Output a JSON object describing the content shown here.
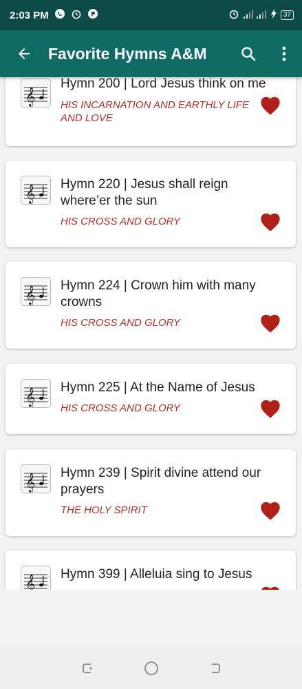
{
  "status_bar": {
    "time": "2:03 PM",
    "battery": "37"
  },
  "app_bar": {
    "title": "Favorite Hymns A&M"
  },
  "hymns": [
    {
      "title": "Hymn 200 | Lord Jesus think on me",
      "category": "HIS INCARNATION AND EARTHLY LIFE AND LOVE",
      "favorite": true
    },
    {
      "title": "Hymn 220 |  Jesus shall reign where’er the sun",
      "category": "HIS CROSS AND GLORY",
      "favorite": true
    },
    {
      "title": "Hymn 224 |  Crown him with many crowns",
      "category": "HIS CROSS AND GLORY",
      "favorite": true
    },
    {
      "title": "Hymn 225 |  At the Name of Jesus",
      "category": "HIS CROSS AND GLORY",
      "favorite": true
    },
    {
      "title": "Hymn 239 |  Spirit divine attend our prayers",
      "category": "THE HOLY SPIRIT",
      "favorite": true
    },
    {
      "title": "Hymn 399 | Alleluia sing to Jesus",
      "category": "",
      "favorite": true
    }
  ],
  "colors": {
    "appbar": "#0f6b63",
    "statusbar": "#0b4a46",
    "heart": "#b0201a",
    "category": "#b0302a"
  }
}
